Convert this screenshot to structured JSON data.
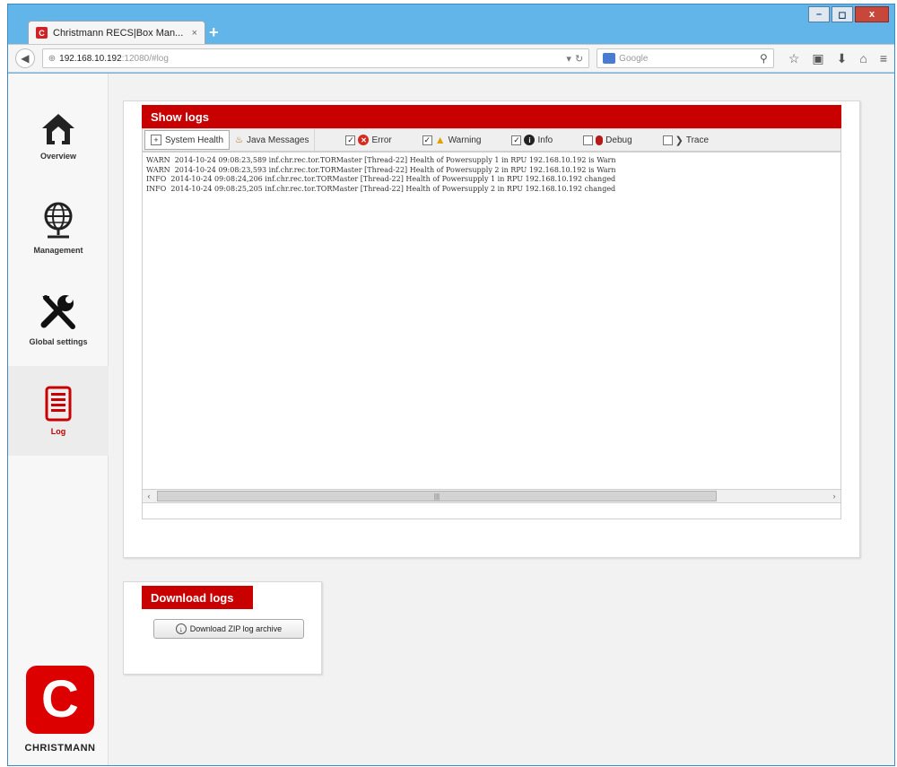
{
  "browser": {
    "tab_title": "Christmann RECS|Box Man...",
    "tab_close": "×",
    "new_tab": "+",
    "window_buttons": [
      "–",
      "◻",
      "x"
    ],
    "url_host": "192.168.10.192",
    "url_path": ":12080/#log",
    "search_placeholder": "Google"
  },
  "sidebar": {
    "items": [
      {
        "label": "Overview",
        "icon": "home-icon"
      },
      {
        "label": "Management",
        "icon": "globe-icon"
      },
      {
        "label": "Global settings",
        "icon": "tools-icon"
      },
      {
        "label": "Log",
        "icon": "document-icon",
        "active": true
      }
    ],
    "logo_letter": "C",
    "logo_text": "CHRISTMANN"
  },
  "show_logs": {
    "title": "Show logs",
    "tabs": [
      {
        "label": "System Health",
        "active": true
      },
      {
        "label": "Java Messages",
        "active": false
      }
    ],
    "filters": [
      {
        "label": "Error",
        "checked": true
      },
      {
        "label": "Warning",
        "checked": true
      },
      {
        "label": "Info",
        "checked": true
      },
      {
        "label": "Debug",
        "checked": false
      },
      {
        "label": "Trace",
        "checked": false
      }
    ],
    "log_lines": [
      "WARN  2014-10-24 09:08:23,589 inf.chr.rec.tor.TORMaster [Thread-22] Health of Powersupply 1 in RPU 192.168.10.192 is Warn",
      "WARN  2014-10-24 09:08:23,593 inf.chr.rec.tor.TORMaster [Thread-22] Health of Powersupply 2 in RPU 192.168.10.192 is Warn",
      "INFO  2014-10-24 09:08:24,206 inf.chr.rec.tor.TORMaster [Thread-22] Health of Powersupply 1 in RPU 192.168.10.192 changed",
      "INFO  2014-10-24 09:08:25,205 inf.chr.rec.tor.TORMaster [Thread-22] Health of Powersupply 2 in RPU 192.168.10.192 changed"
    ],
    "scroll_left": "‹",
    "scroll_right": "›",
    "scroll_grip": "|||"
  },
  "download_logs": {
    "title": "Download logs",
    "button_label": "Download ZIP log archive"
  },
  "colors": {
    "accent_red": "#c80000",
    "browser_blue": "#62b5e8"
  }
}
